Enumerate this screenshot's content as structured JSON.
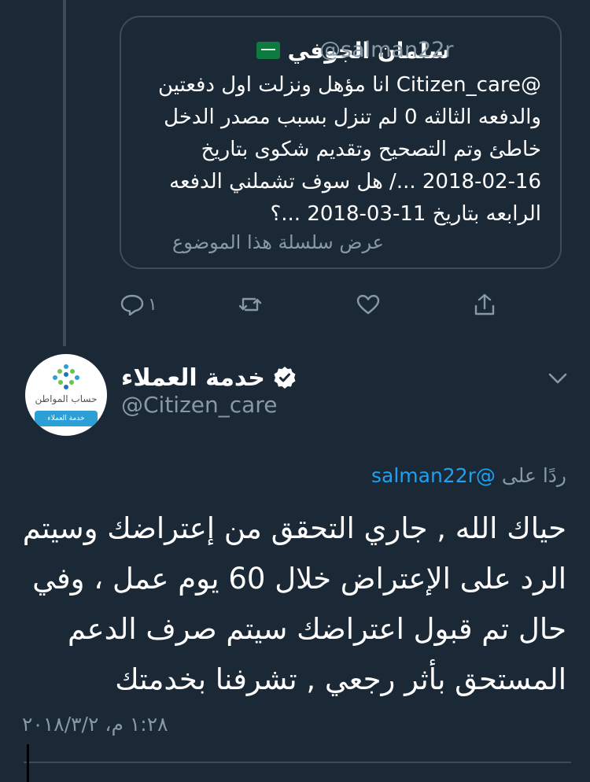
{
  "quoted_tweet": {
    "author_name": "سلمان الجوفي",
    "flag_icon": "saudi-flag-icon",
    "handle": "@salman22r",
    "lines": [
      "@Citizen_care انا مؤهل ونزلت اول دفعتين",
      "والدفعه الثالثه 0 لم تنزل بسبب مصدر الدخل",
      "خاطئ وتم التصحيح وتقديم شكوى بتاريخ",
      "2018-02-16 .../ هل سوف تشملني الدفعه",
      "الرابعه بتاريخ 11-03-2018 ...؟"
    ],
    "show_thread": "عرض سلسلة هذا الموضوع",
    "reply_count": "١"
  },
  "reply_tweet": {
    "author_name": "خدمة العملاء",
    "verified": true,
    "handle": "@Citizen_care",
    "avatar_text": "حساب المواطن",
    "avatar_badge": "خدمة العملاء",
    "replying_to_label": "ردًا على",
    "replying_to_handle": "@salman22r",
    "lines": [
      "حياك الله , جاري التحقق من إعتراضك وسيتم",
      "الرد على الإعتراض خلال 60 يوم عمل ، وفي",
      "حال تم قبول اعتراضك سيتم صرف الدعم",
      "المستحق بأثر رجعي , تشرفنا بخدمتك"
    ],
    "timestamp": "١:٢٨ م، ٢٠١٨/٣/٢"
  },
  "colors": {
    "background": "#1b2836",
    "secondary_text": "#8899a6",
    "link": "#1da1f2",
    "border": "#3e4c5a"
  }
}
